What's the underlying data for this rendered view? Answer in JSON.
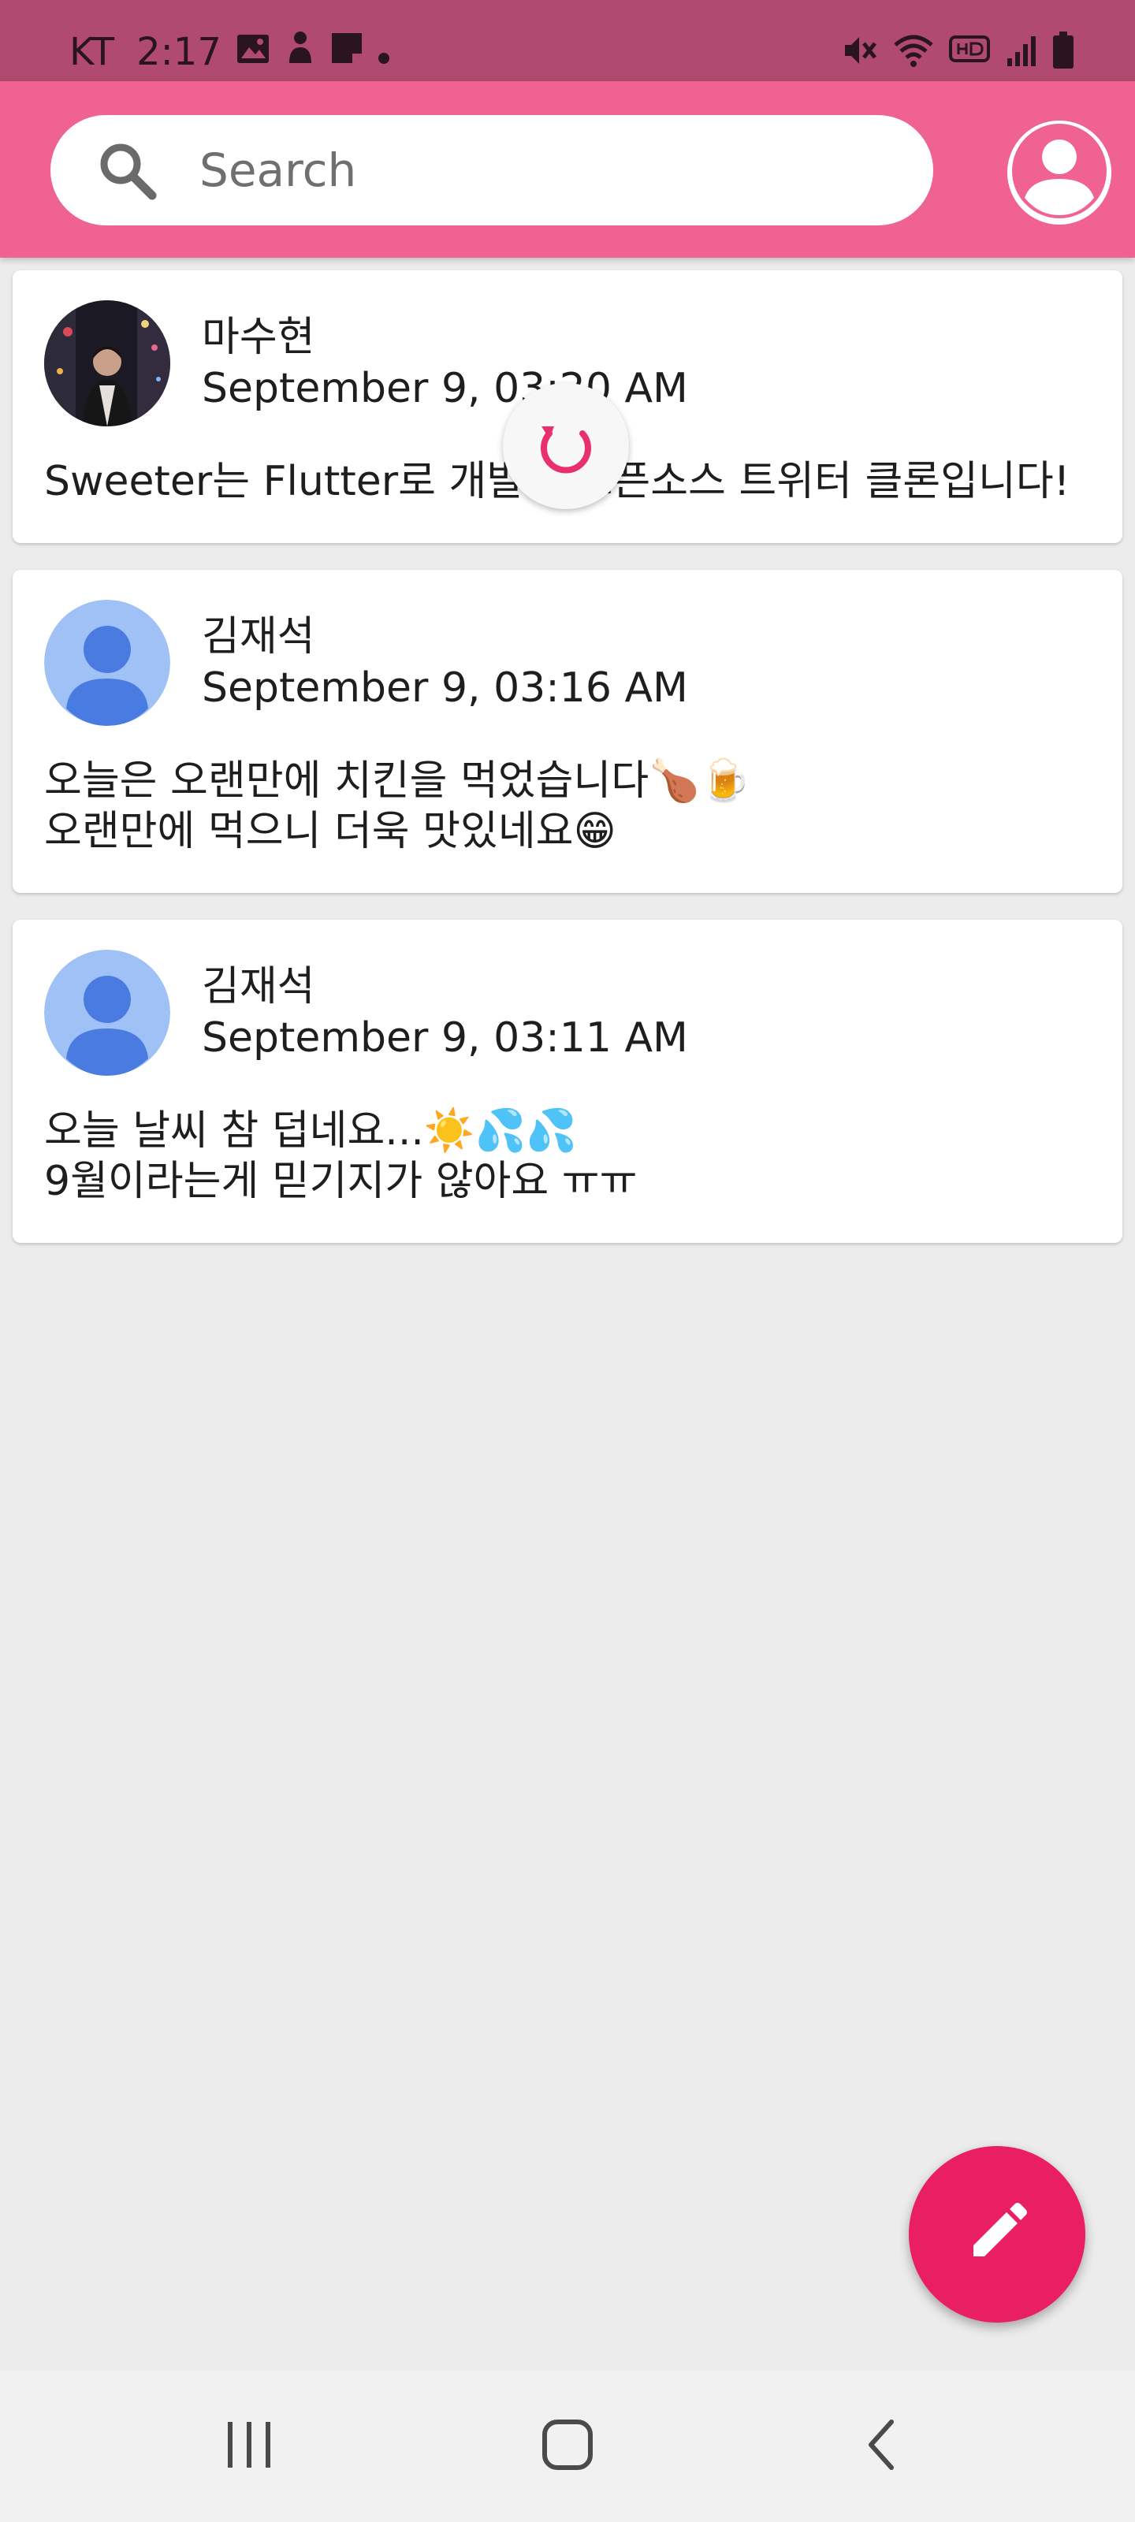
{
  "status_bar": {
    "carrier": "KT",
    "time": "2:17",
    "left_icons": [
      "gallery-icon",
      "person-icon",
      "sticky-note-icon",
      "dot-icon"
    ],
    "right_icons": [
      "mute-icon",
      "wifi-icon",
      "hd-call-icon",
      "signal-icon",
      "battery-icon"
    ]
  },
  "app_bar": {
    "search_placeholder": "Search",
    "background_color": "#f06292"
  },
  "posts": [
    {
      "author": "마수현",
      "timestamp": "September 9, 03:20 AM",
      "lines": [
        "Sweeter는 Flutter로 개발된 오픈소스 트위터 클론입니다!"
      ],
      "avatar": "photo"
    },
    {
      "author": "김재석",
      "timestamp": "September 9, 03:16 AM",
      "lines": [
        "오늘은 오랜만에 치킨을 먹었습니다🍗🍺",
        "오랜만에 먹으니 더욱 맛있네요😁"
      ],
      "avatar": "default"
    },
    {
      "author": "김재석",
      "timestamp": "September 9, 03:11 AM",
      "lines": [
        "오늘 날씨 참 덥네요...☀️💦💦",
        "9월이라는게 믿기지가 않아요 ㅠㅠ"
      ],
      "avatar": "default"
    }
  ],
  "fab": {
    "icon": "edit-icon",
    "color": "#e91e63"
  },
  "nav_bar": {
    "icons": [
      "recent-apps-icon",
      "home-icon",
      "back-icon"
    ]
  }
}
